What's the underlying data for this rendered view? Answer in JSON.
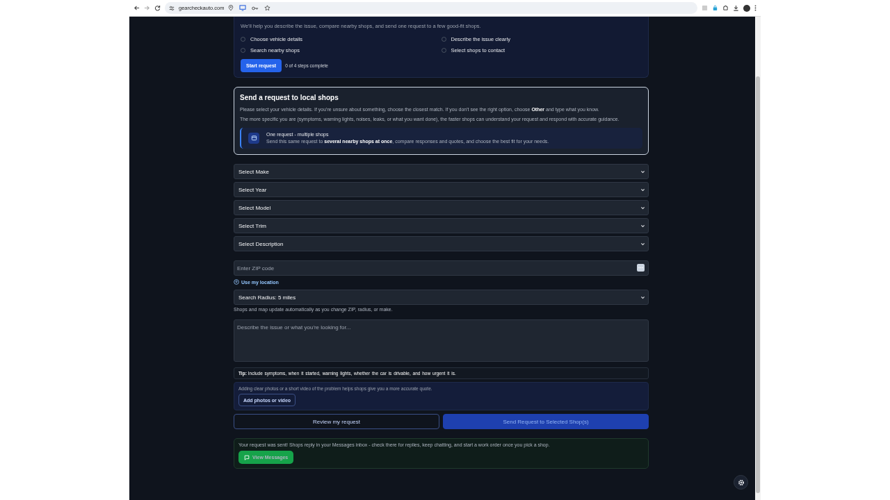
{
  "browser": {
    "url": "gearcheckauto.com"
  },
  "intro": {
    "subtitle": "We'll help you describe the issue, compare nearby shops, and send one request to a few good-fit shops.",
    "steps": [
      {
        "label": "Choose vehicle details",
        "checked": false
      },
      {
        "label": "Describe the issue clearly",
        "checked": false
      },
      {
        "label": "Search nearby shops",
        "checked": false
      },
      {
        "label": "Select shops to contact",
        "checked": false
      }
    ],
    "start_button": "Start request",
    "progress": "0 of 4 steps complete"
  },
  "request_card": {
    "title": "Send a request to local shops",
    "paragraphs": [
      "Please select your vehicle details. If you're unsure about something, choose the closest match. If you don't see the right option, choose **Other** and type what you know.",
      "The more specific you are (symptoms, warning lights, noises, leaks, or what you want done), the faster shops can understand your request and respond with accurate guidance."
    ],
    "callout": {
      "title": "One request - multiple shops",
      "text": "Send this same request to **several nearby shops at once**, compare responses and quotes, and choose the best fit for your needs."
    }
  },
  "vehicle_selects": [
    "Select Make",
    "Select Year",
    "Select Model",
    "Select Trim",
    "Select Description"
  ],
  "zip": {
    "placeholder": "Enter ZIP code"
  },
  "location_link": "Use my location",
  "radius": "Search Radius: 5 miles",
  "radius_hint": "Shops and map update automatically as you change ZIP, radius, or make.",
  "description": {
    "placeholder": "Describe the issue or what you're looking for..."
  },
  "tip": "**Tip:** Include symptoms, when it started, warning lights, whether the car is drivable, and how urgent it is.",
  "photos": {
    "text": "Adding clear photos or a short video of the problem helps shops give you a more accurate quote.",
    "button": "Add photos or video"
  },
  "actions": [
    {
      "label": "Review my request",
      "kind": "outline"
    },
    {
      "label": "Send Request to Selected Shop(s)",
      "kind": "primary"
    }
  ],
  "success": {
    "text": "Your request was sent! Shops reply in your Messages inbox - check there for replies, keep chatting, and start a work order once you pick a shop.",
    "button": "View Messages"
  }
}
